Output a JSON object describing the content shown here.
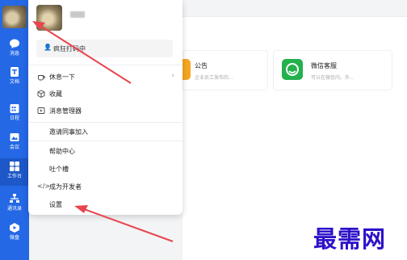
{
  "sidebar": {
    "items": [
      {
        "label": "消息",
        "icon": "chat-icon"
      },
      {
        "label": "文档",
        "icon": "document-icon"
      },
      {
        "label": "日程",
        "icon": "calendar-icon"
      },
      {
        "label": "会议",
        "icon": "meeting-icon"
      },
      {
        "label": "工作台",
        "icon": "workbench-icon"
      },
      {
        "label": "通讯录",
        "icon": "contacts-icon"
      },
      {
        "label": "微盘",
        "icon": "drive-icon"
      }
    ]
  },
  "popup": {
    "status_emoji": "👤",
    "status_text": "疯狂打码中",
    "menu": {
      "rest": "休息一下",
      "favorites": "收藏",
      "message_manager": "消息管理器",
      "invite": "邀请同事加入",
      "help": "帮助中心",
      "feedback": "吐个槽",
      "developer": "成为开发者",
      "settings": "设置"
    }
  },
  "cards": {
    "announcement": {
      "title": "公告",
      "subtitle": "企业员工发布的...",
      "color": "#f5a623"
    },
    "wechat_service": {
      "title": "微信客服",
      "subtitle": "可以在微信内、外...",
      "color": "#23b14d"
    }
  },
  "watermark": "最需网",
  "colors": {
    "sidebar": "#2468e6",
    "arrow": "#e8454f"
  }
}
